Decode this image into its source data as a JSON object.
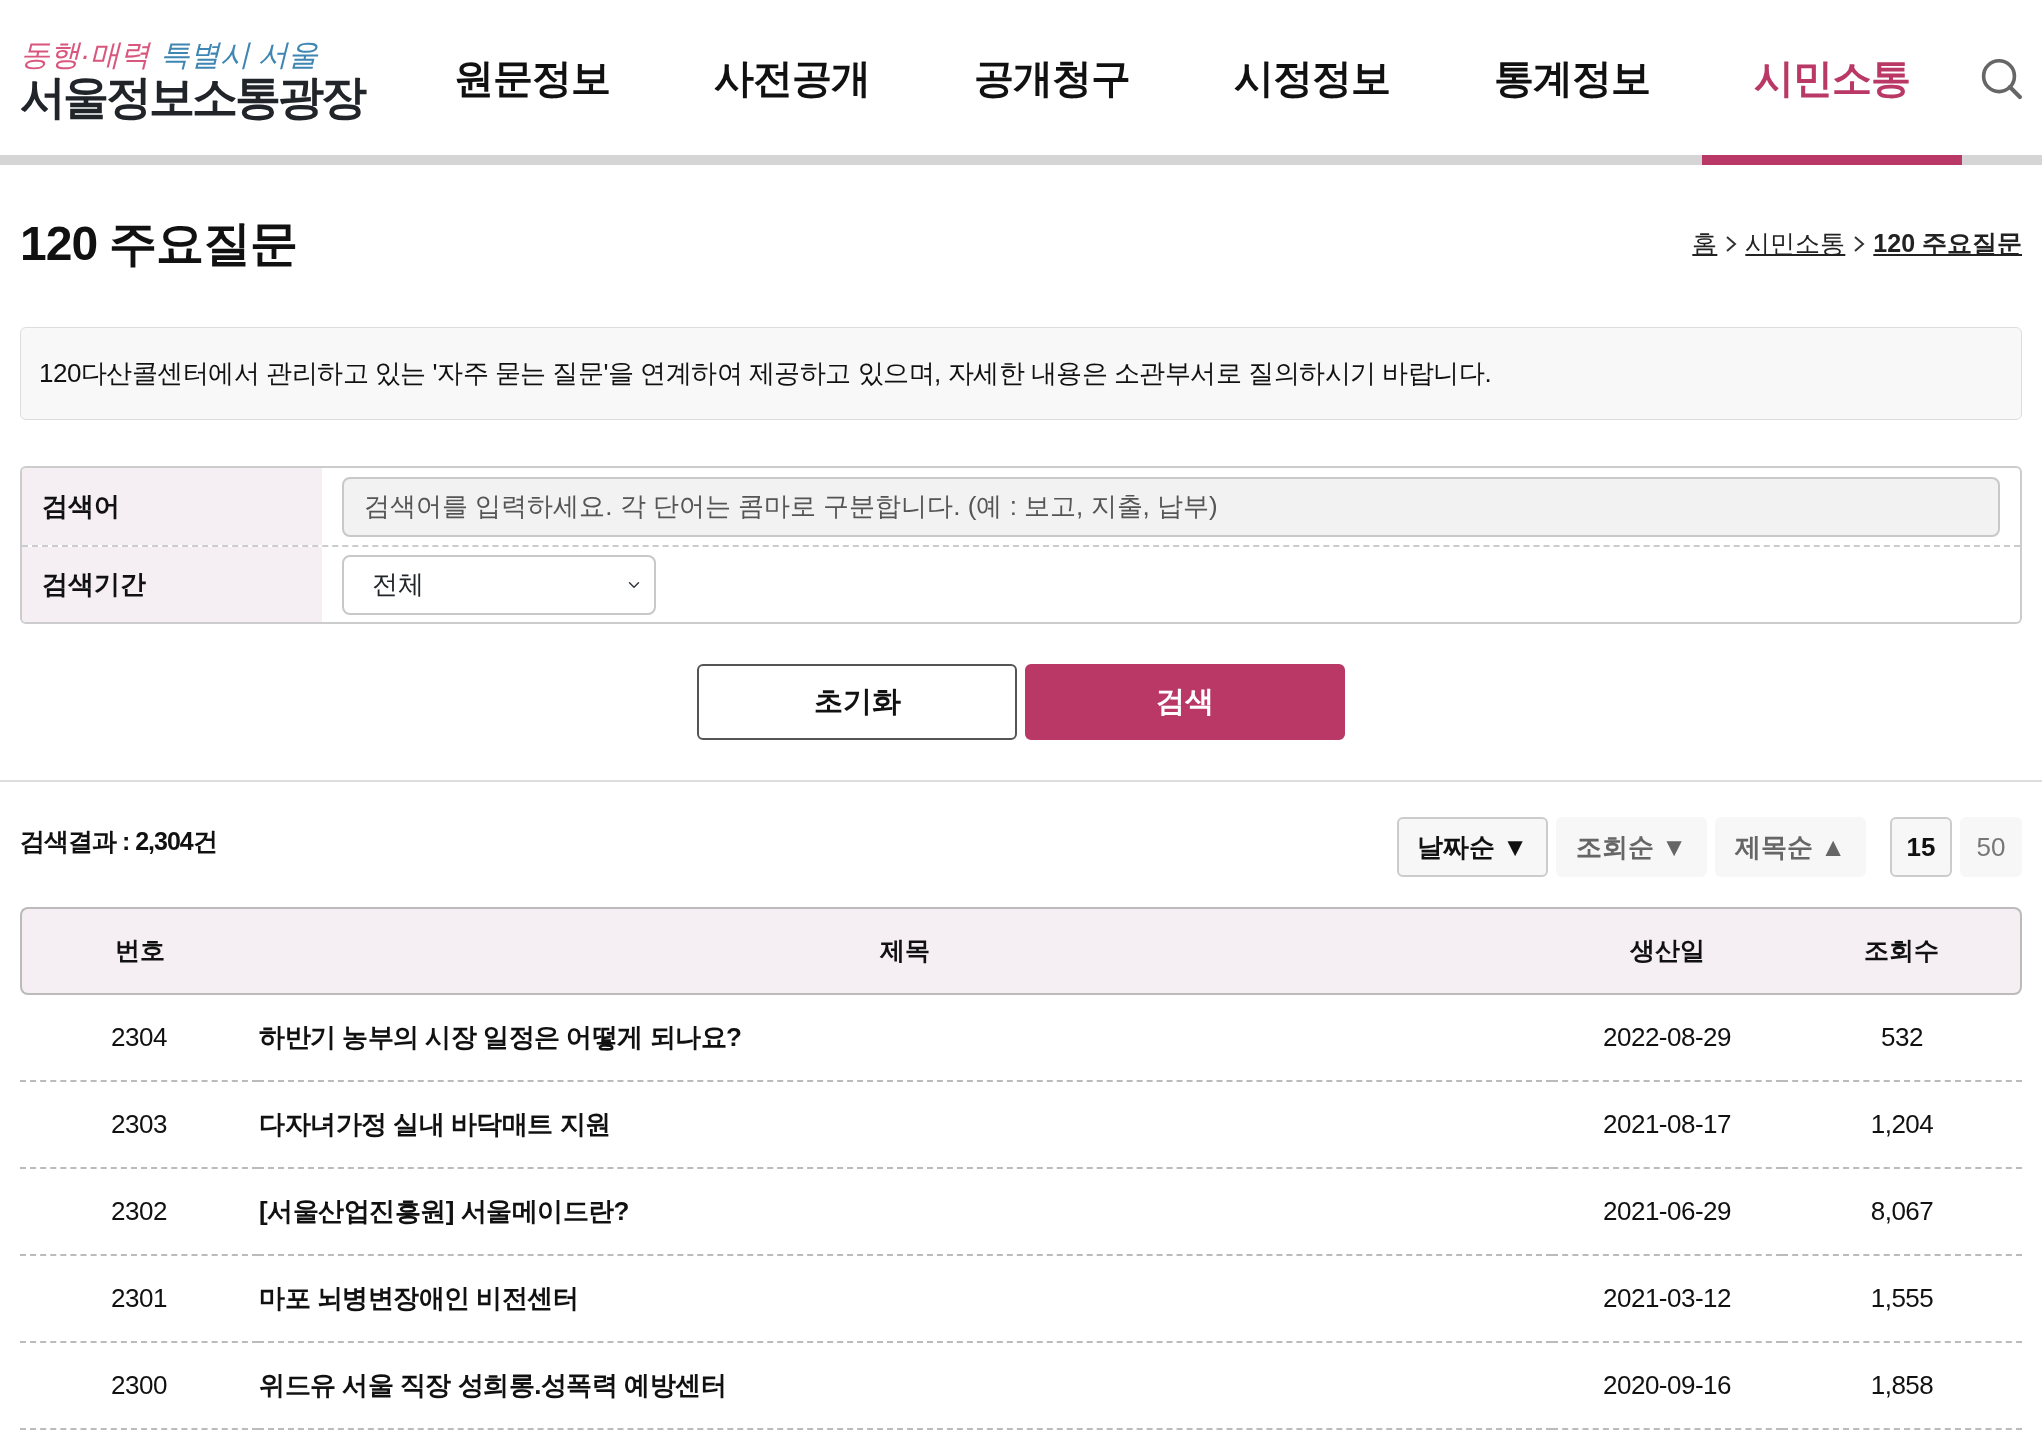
{
  "logo": {
    "slogan_1": "동행·매력",
    "slogan_2": "특별시 서울",
    "title": "서울정보소통광장"
  },
  "nav": [
    {
      "label": "원문정보",
      "selected": false
    },
    {
      "label": "사전공개",
      "selected": false
    },
    {
      "label": "공개청구",
      "selected": false
    },
    {
      "label": "시정정보",
      "selected": false
    },
    {
      "label": "통계정보",
      "selected": false
    },
    {
      "label": "시민소통",
      "selected": true
    }
  ],
  "page_title": "120 주요질문",
  "breadcrumb": [
    {
      "label": "홈",
      "current": false
    },
    {
      "label": "시민소통",
      "current": false
    },
    {
      "label": "120 주요질문",
      "current": true
    }
  ],
  "notice": "120다산콜센터에서 관리하고 있는 '자주 묻는 질문'을 연계하여 제공하고 있으며, 자세한 내용은 소관부서로 질의하시기 바랍니다.",
  "search": {
    "keyword_label": "검색어",
    "placeholder": "검색어를 입력하세요. 각 단어는 콤마로 구분합니다. (예 : 보고, 지출, 납부)",
    "period_label": "검색기간",
    "period_value": "전체"
  },
  "buttons": [
    {
      "label": "초기화",
      "kind": "outline"
    },
    {
      "label": "검색",
      "kind": "primary"
    }
  ],
  "result_count": "검색결과 : 2,304건",
  "sort_options": [
    {
      "label": "날짜순 ▼",
      "selected": true
    },
    {
      "label": "조회순 ▼",
      "selected": false
    },
    {
      "label": "제목순 ▲",
      "selected": false
    }
  ],
  "page_sizes": [
    {
      "label": "15",
      "selected": true
    },
    {
      "label": "50",
      "selected": false
    }
  ],
  "table": {
    "columns": [
      "번호",
      "제목",
      "생산일",
      "조회수"
    ],
    "rows": [
      [
        "2304",
        "하반기 농부의 시장 일정은 어떻게 되나요?",
        "2022-08-29",
        "532"
      ],
      [
        "2303",
        "다자녀가정 실내 바닥매트 지원",
        "2021-08-17",
        "1,204"
      ],
      [
        "2302",
        "[서울산업진흥원] 서울메이드란?",
        "2021-06-29",
        "8,067"
      ],
      [
        "2301",
        "마포 뇌병변장애인 비전센터",
        "2021-03-12",
        "1,555"
      ],
      [
        "2300",
        "위드유 서울 직장 성희롱.성폭력 예방센터",
        "2020-09-16",
        "1,858"
      ]
    ]
  }
}
